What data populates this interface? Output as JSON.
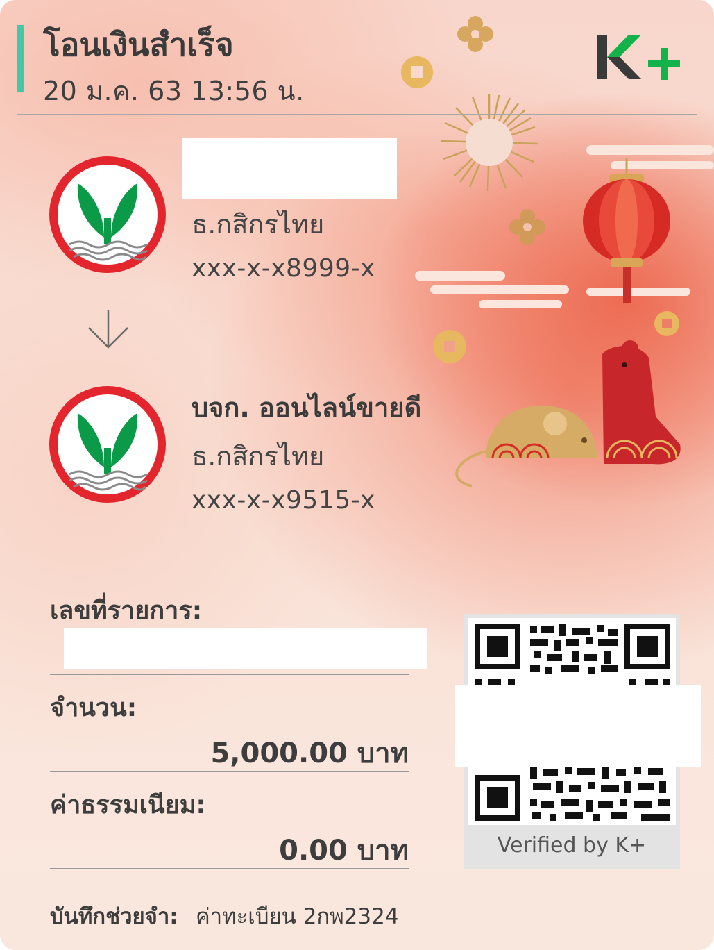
{
  "header": {
    "title": "โอนเงินสำเร็จ",
    "datetime": "20 ม.ค. 63  13:56 น.",
    "brand_logo": "K+"
  },
  "sender": {
    "bank_logo": "kasikorn-bank-logo",
    "name": "",
    "bank": "ธ.กสิกรไทย",
    "account": "xxx-x-x8999-x"
  },
  "recipient": {
    "bank_logo": "kasikorn-bank-logo",
    "name": "บจก. ออนไลน์ขายดี",
    "bank": "ธ.กสิกรไทย",
    "account": "xxx-x-x9515-x"
  },
  "details": {
    "ref_label": "เลขที่รายการ:",
    "ref_value": "",
    "amount_label": "จำนวน:",
    "amount_value": "5,000.00 บาท",
    "fee_label": "ค่าธรรมเนียม:",
    "fee_value": "0.00 บาท"
  },
  "qr": {
    "verified_text": "Verified by K+"
  },
  "memo": {
    "label": "บันทึกช่วยจำ:",
    "value": "ค่าทะเบียน 2กพ2324"
  },
  "colors": {
    "accent_bar": "#46c8a8",
    "kplus_green": "#13b24a",
    "bank_logo_red": "#e3262d",
    "bank_logo_green": "#0b9a47",
    "lantern_red": "#d62b25",
    "decor_gold": "#c9a25a"
  },
  "icons": {
    "arrow": "arrow-down-icon",
    "lantern": "lantern-icon",
    "rat": "rat-illustration",
    "coin": "coin-icon",
    "sunburst": "sunburst-icon",
    "flower": "flower-icon"
  }
}
